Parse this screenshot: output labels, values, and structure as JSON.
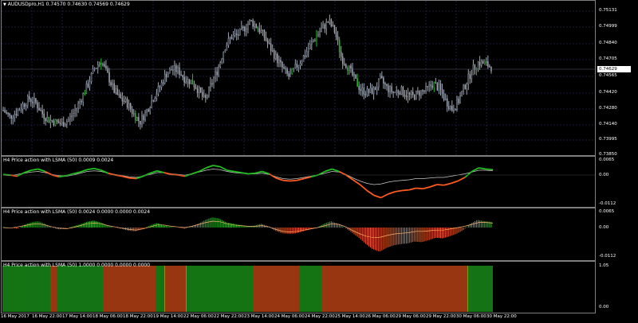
{
  "main_chart": {
    "title": "AUDUSDpro,H1  0.74570 0.74630 0.74569 0.74629",
    "current_price": "0.74629",
    "y_ticks": [
      "0.75131",
      "0.74999",
      "0.74840",
      "0.74705",
      "0.74565",
      "0.74420",
      "0.74280",
      "0.74140",
      "0.73995",
      "0.73850"
    ]
  },
  "indicator1": {
    "title": "H4 Price action with LSMA (50) 0.0009 0.0024",
    "y_ticks": [
      "0.0065",
      "0.00",
      "-0.0112"
    ]
  },
  "indicator2": {
    "title": "H4 Price action with LSMA (50) 0.0024 0.0000 0.0000 0.0024",
    "y_ticks": [
      "0.0065",
      "0.00",
      "-0.0112"
    ]
  },
  "indicator3": {
    "title": "H4 Price action with LSMA (50) 1.0000 0.0000 0.0000 0.0000",
    "y_ticks": [
      "1.05",
      "0.00"
    ]
  },
  "x_labels": [
    "16 May 2017",
    "16 May 22:00",
    "17 May 14:00",
    "18 May 06:00",
    "18 May 22:00",
    "19 May 14:00",
    "22 May 06:00",
    "22 May 22:00",
    "23 May 14:00",
    "24 May 06:00",
    "24 May 22:00",
    "25 May 14:00",
    "26 May 06:00",
    "29 May 06:00",
    "29 May 22:00",
    "30 May 06:00",
    "30 May 22:00"
  ],
  "colors": {
    "bull": "#21c021",
    "bear": "#ff5a1f",
    "candle": "#9ea6b2",
    "grid": "#1a1a3c",
    "axis": "#808080"
  },
  "chart_data": [
    {
      "type": "candlestick",
      "title": "AUDUSDpro,H1",
      "ylim": [
        0.7381,
        0.7516
      ],
      "close": [
        0.7421,
        0.7415,
        0.7419,
        0.7426,
        0.7432,
        0.7428,
        0.7418,
        0.7412,
        0.741,
        0.7408,
        0.7412,
        0.742,
        0.7432,
        0.7445,
        0.746,
        0.7468,
        0.7455,
        0.744,
        0.7432,
        0.7428,
        0.7418,
        0.741,
        0.742,
        0.7432,
        0.7442,
        0.7455,
        0.746,
        0.7458,
        0.745,
        0.7448,
        0.744,
        0.743,
        0.7446,
        0.746,
        0.748,
        0.749,
        0.7492,
        0.7498,
        0.7505,
        0.75,
        0.7492,
        0.748,
        0.747,
        0.746,
        0.7452,
        0.7462,
        0.747,
        0.748,
        0.749,
        0.7498,
        0.7505,
        0.7495,
        0.747,
        0.7462,
        0.745,
        0.744,
        0.7438,
        0.744,
        0.745,
        0.7442,
        0.7438,
        0.744,
        0.7436,
        0.7434,
        0.7438,
        0.744,
        0.7446,
        0.7442,
        0.743,
        0.7422,
        0.743,
        0.7445,
        0.7458,
        0.7466,
        0.7465,
        0.7462
      ],
      "indicator_lines": {
        "signal": [
          0.1,
          0.0,
          -0.2,
          0.4,
          0.8,
          1.0,
          0.6,
          0.0,
          -0.3,
          -0.1,
          0.2,
          0.5,
          0.9,
          1.1,
          0.8,
          0.3,
          0.0,
          -0.2,
          -0.5,
          -0.6,
          -0.2,
          0.3,
          0.7,
          0.4,
          0.1,
          0.0,
          -0.2,
          0.2,
          0.6,
          1.2,
          1.6,
          1.4,
          0.8,
          0.6,
          0.4,
          0.2,
          0.3,
          0.6,
          0.2,
          -0.5,
          -0.9,
          -1.0,
          -0.9,
          -0.6,
          -0.3,
          0.0,
          0.6,
          1.0,
          0.6,
          0.0,
          -0.8,
          -1.6,
          -2.6,
          -3.4,
          -3.8,
          -3.2,
          -2.8,
          -2.6,
          -2.5,
          -2.2,
          -2.3,
          -2.0,
          -1.6,
          -1.7,
          -1.4,
          -1.0,
          -0.4,
          0.6,
          1.2,
          1.0,
          0.9
        ],
        "lsma": [
          0.0,
          -0.1,
          0.1,
          0.3,
          0.5,
          0.6,
          0.4,
          0.1,
          -0.1,
          -0.2,
          0.0,
          0.3,
          0.6,
          0.7,
          0.6,
          0.3,
          0.1,
          -0.1,
          -0.3,
          -0.4,
          -0.2,
          0.1,
          0.4,
          0.4,
          0.2,
          0.1,
          0.0,
          0.2,
          0.5,
          0.8,
          1.0,
          0.9,
          0.6,
          0.4,
          0.3,
          0.2,
          0.2,
          0.3,
          0.1,
          -0.3,
          -0.6,
          -0.7,
          -0.6,
          -0.4,
          -0.2,
          0.0,
          0.3,
          0.6,
          0.5,
          0.1,
          -0.5,
          -1.0,
          -1.4,
          -1.6,
          -1.5,
          -1.2,
          -1.0,
          -0.9,
          -0.8,
          -0.6,
          -0.6,
          -0.5,
          -0.4,
          -0.4,
          -0.2,
          0.0,
          0.2,
          0.5,
          0.8,
          0.8,
          0.7
        ]
      }
    }
  ]
}
